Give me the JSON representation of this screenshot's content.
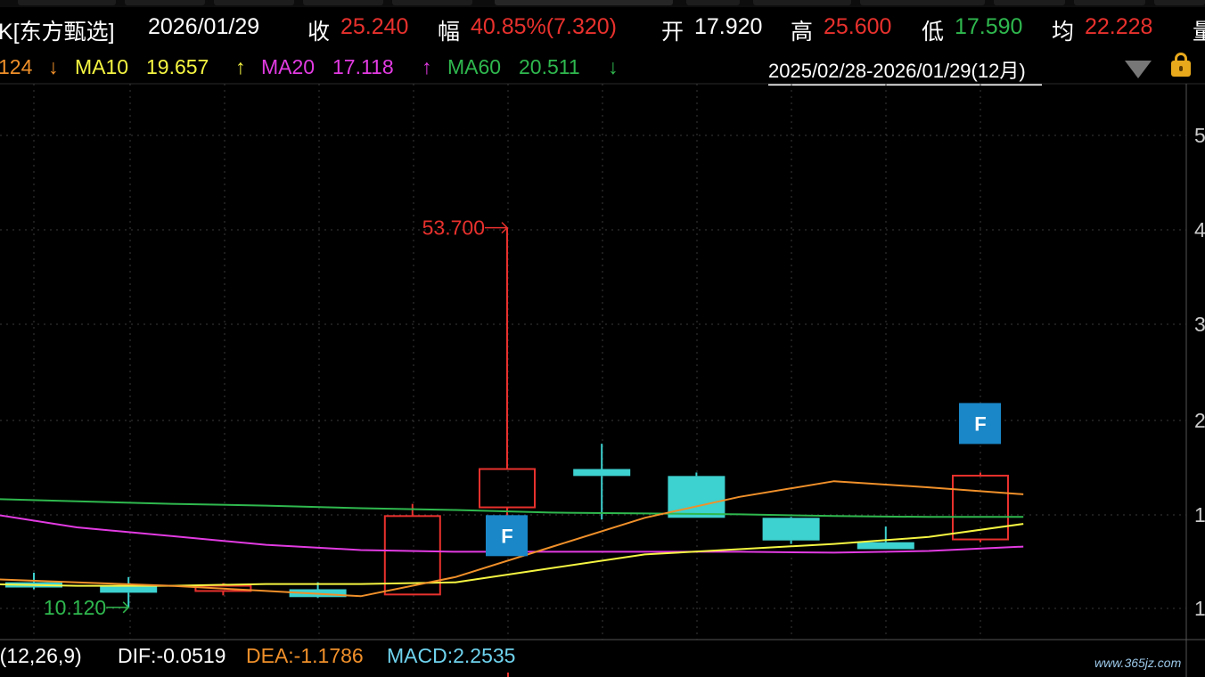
{
  "header": {
    "name": "K[东方甄选]",
    "date": "2026/01/29",
    "close_label": "收",
    "close_value": "25.240",
    "change_label": "幅",
    "change_value": "40.85%(7.320)",
    "open_label": "开",
    "open_value": "17.920",
    "high_label": "高",
    "high_value": "25.600",
    "low_label": "低",
    "low_value": "17.590",
    "avg_label": "均",
    "avg_value": "22.228",
    "extra_label": "量"
  },
  "ma_bar": {
    "ma5_value": "124",
    "ma5_arrow": "↓",
    "ma10_label": "MA10",
    "ma10_value": "19.657",
    "ma10_arrow": "↑",
    "ma20_label": "MA20",
    "ma20_value": "17.118",
    "ma20_arrow": "↑",
    "ma60_label": "MA60",
    "ma60_value": "20.511",
    "ma60_arrow": "↓"
  },
  "period_range": "2025/02/28-2026/01/29(12月)",
  "macd_bar": {
    "params": ")(12,26,9)",
    "dif": "DIF:-0.0519",
    "dea": "DEA:-1.1786",
    "macd": "MACD:2.2535"
  },
  "watermark": "www.365jz.com",
  "colors": {
    "up": "#e8312d",
    "down": "#3dd1cf",
    "ma5": "#f0902a",
    "ma10": "#f5f542",
    "ma20": "#e23be2",
    "ma60": "#2fb84e",
    "marker": "#1a87c8"
  },
  "chart_data": {
    "type": "candlestick",
    "y_tick_labels": [
      "5",
      "4",
      "3",
      "2",
      "1",
      "1"
    ],
    "candles": [
      {
        "o": 13.0,
        "h": 14.1,
        "l": 12.2,
        "c": 12.4,
        "dir": "down"
      },
      {
        "o": 12.6,
        "h": 13.6,
        "l": 10.12,
        "c": 11.8,
        "dir": "down"
      },
      {
        "o": 12.0,
        "h": 12.9,
        "l": 11.5,
        "c": 12.6,
        "dir": "up"
      },
      {
        "o": 12.2,
        "h": 13.0,
        "l": 11.2,
        "c": 11.3,
        "dir": "down"
      },
      {
        "o": 11.6,
        "h": 22.0,
        "l": 11.6,
        "c": 20.6,
        "dir": "up"
      },
      {
        "o": 21.6,
        "h": 53.7,
        "l": 20.5,
        "c": 26.0,
        "dir": "up"
      },
      {
        "o": 26.0,
        "h": 28.9,
        "l": 20.2,
        "c": 25.2,
        "dir": "down"
      },
      {
        "o": 25.2,
        "h": 25.6,
        "l": 20.4,
        "c": 20.4,
        "dir": "down"
      },
      {
        "o": 20.4,
        "h": 20.5,
        "l": 17.4,
        "c": 17.8,
        "dir": "down"
      },
      {
        "o": 17.6,
        "h": 19.4,
        "l": 16.8,
        "c": 16.8,
        "dir": "down"
      },
      {
        "o": 17.92,
        "h": 25.6,
        "l": 17.59,
        "c": 25.24,
        "dir": "up"
      }
    ],
    "markers": [
      {
        "label": "F",
        "candle": 5
      },
      {
        "label": "F",
        "candle": 10
      }
    ],
    "annotations": [
      {
        "text": "53.700",
        "candle": 5,
        "value": 53.7
      },
      {
        "text": "10.120",
        "candle": 1,
        "value": 10.12
      }
    ],
    "series": [
      {
        "name": "MA60",
        "key": "ma60",
        "values": [
          22.6,
          22.3,
          22.0,
          21.8,
          21.5,
          21.3,
          21.0,
          20.9,
          20.8,
          20.6,
          20.5,
          20.5
        ]
      },
      {
        "name": "MA20",
        "key": "ma20",
        "values": [
          21.0,
          19.3,
          18.3,
          17.3,
          16.7,
          16.5,
          16.5,
          16.5,
          16.5,
          16.4,
          16.6,
          17.1
        ]
      },
      {
        "name": "MA10",
        "key": "ma10",
        "values": [
          12.8,
          12.6,
          12.6,
          12.8,
          12.8,
          13.0,
          14.6,
          16.2,
          16.8,
          17.4,
          18.2,
          19.7
        ]
      },
      {
        "name": "MA5",
        "key": "ma5",
        "values": [
          13.4,
          13.0,
          12.6,
          12.0,
          11.4,
          13.6,
          17.0,
          20.4,
          22.8,
          24.6,
          23.9,
          23.1
        ]
      }
    ]
  }
}
